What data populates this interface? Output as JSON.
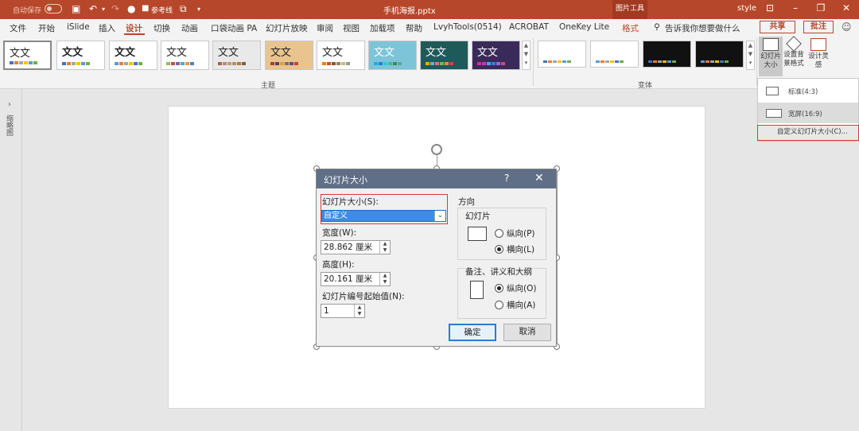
{
  "titlebar": {
    "autosave_label": "自动保存",
    "autosave_state": "关",
    "qa_text": "参考线",
    "doc_title": "手机海报.pptx",
    "context_tab": "图片工具",
    "user": "style"
  },
  "menu": {
    "items": [
      "文件",
      "开始",
      "iSlide",
      "插入",
      "设计",
      "切换",
      "动画",
      "口袋动画 PA",
      "幻灯片放映",
      "审阅",
      "视图",
      "加载项",
      "帮助",
      "LvyhTools(0514)",
      "ACROBAT",
      "OneKey Lite",
      "格式"
    ],
    "active": "设计",
    "tell_me": "告诉我你想要做什么",
    "share": "共享",
    "comment": "批注"
  },
  "ribbon": {
    "theme_text": "文文",
    "themes_group_label": "主题",
    "variants_group_label": "变体",
    "slide_size_label": "幻灯片大小",
    "format_bg_label": "设置背景格式",
    "designer_label": "设计灵感"
  },
  "left_pane": {
    "label": "缩略图"
  },
  "dropdown": {
    "standard": "标准(4:3)",
    "widescreen": "宽屏(16:9)",
    "custom": "自定义幻灯片大小(C)..."
  },
  "dialog": {
    "title": "幻灯片大小",
    "help": "?",
    "slide_size_label": "幻灯片大小(S):",
    "slide_size_value": "自定义",
    "width_label": "宽度(W):",
    "width_value": "28.862 厘米",
    "height_label": "高度(H):",
    "height_value": "20.161 厘米",
    "number_from_label": "幻灯片编号起始值(N):",
    "number_from_value": "1",
    "orientation_label": "方向",
    "slides_label": "幻灯片",
    "portrait": "纵向(P)",
    "landscape": "横向(L)",
    "slides_orientation": "landscape",
    "notes_label": "备注、讲义和大纲",
    "notes_portrait": "纵向(O)",
    "notes_landscape": "横向(A)",
    "notes_orientation": "portrait",
    "ok": "确定",
    "cancel": "取消"
  },
  "colors": {
    "accent": "#b7472a",
    "dialog_title": "#5e6f87",
    "highlight": "#d9393b",
    "select_blue": "#3d8ee2"
  }
}
